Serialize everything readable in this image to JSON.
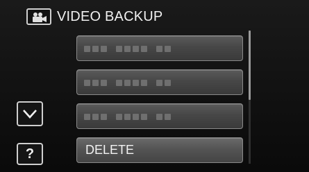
{
  "header": {
    "title": "VIDEO BACKUP",
    "mode_icon": "video-camera-icon"
  },
  "menu": {
    "items": [
      {
        "type": "placeholder",
        "label": ""
      },
      {
        "type": "placeholder",
        "label": ""
      },
      {
        "type": "placeholder",
        "label": ""
      },
      {
        "type": "option",
        "label": "DELETE"
      }
    ]
  },
  "controls": {
    "scroll_down_icon": "chevron-down-icon",
    "help_label": "?"
  },
  "colors": {
    "background": "#101010",
    "button_fill": "#4a4a4a",
    "text": "#f0f0f0"
  }
}
